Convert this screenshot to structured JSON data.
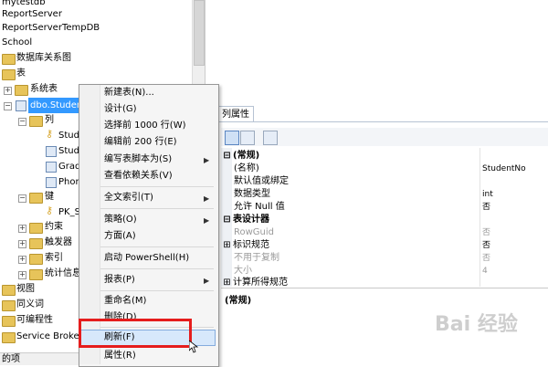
{
  "explorer": {
    "items": [
      {
        "label": "mytestdb",
        "level": 0
      },
      {
        "label": "ReportServer",
        "level": 0
      },
      {
        "label": "ReportServerTempDB",
        "level": 0
      },
      {
        "label": "School",
        "level": 0
      },
      {
        "label": "数据库关系图",
        "level": 1
      },
      {
        "label": "表",
        "level": 1
      },
      {
        "label": "系统表",
        "level": 2
      },
      {
        "label": "dbo.Studen",
        "level": 2,
        "selected": true
      },
      {
        "label": "列",
        "level": 3
      },
      {
        "label": "Studen",
        "level": 4
      },
      {
        "label": "Studen",
        "level": 4
      },
      {
        "label": "Grad",
        "level": 4
      },
      {
        "label": "Phor",
        "level": 4
      },
      {
        "label": "键",
        "level": 3
      },
      {
        "label": "PK_S",
        "level": 4
      },
      {
        "label": "约束",
        "level": 3
      },
      {
        "label": "触发器",
        "level": 3
      },
      {
        "label": "索引",
        "level": 3
      },
      {
        "label": "统计信息",
        "level": 3
      },
      {
        "label": "视图",
        "level": 1
      },
      {
        "label": "同义词",
        "level": 1
      },
      {
        "label": "可编程性",
        "level": 1
      },
      {
        "label": "Service Broke",
        "level": 1
      }
    ]
  },
  "statusbar": {
    "text": "的项"
  },
  "context_menu": {
    "items": [
      {
        "label": "新建表(N)...",
        "submenu": false
      },
      {
        "label": "设计(G)",
        "submenu": false
      },
      {
        "label": "选择前 1000 行(W)",
        "submenu": false
      },
      {
        "label": "编辑前 200 行(E)",
        "submenu": false
      },
      {
        "label": "编写表脚本为(S)",
        "submenu": true
      },
      {
        "label": "查看依赖关系(V)",
        "submenu": false
      },
      {
        "label": "全文索引(T)",
        "submenu": true
      },
      {
        "label": "策略(O)",
        "submenu": true
      },
      {
        "label": "方面(A)",
        "submenu": false
      },
      {
        "label": "启动 PowerShell(H)",
        "submenu": false
      },
      {
        "label": "报表(P)",
        "submenu": true
      },
      {
        "label": "重命名(M)",
        "submenu": false
      },
      {
        "label": "删除(D)",
        "submenu": false
      },
      {
        "label": "刷新(F)",
        "submenu": false,
        "highlighted": true
      },
      {
        "label": "属性(R)",
        "submenu": false
      }
    ]
  },
  "properties": {
    "tab_label": "列属性",
    "rows": [
      {
        "name": "(常规)",
        "value": "",
        "category": true
      },
      {
        "name": "(名称)",
        "value": "StudentNo"
      },
      {
        "name": "默认值或绑定",
        "value": ""
      },
      {
        "name": "数据类型",
        "value": "int"
      },
      {
        "name": "允许 Null 值",
        "value": "否"
      },
      {
        "name": "表设计器",
        "value": "",
        "category": true
      },
      {
        "name": "RowGuid",
        "value": "否",
        "dim": true
      },
      {
        "name": "标识规范",
        "value": "否"
      },
      {
        "name": "不用于复制",
        "value": "否",
        "dim": true
      },
      {
        "name": "大小",
        "value": "4",
        "dim": true
      },
      {
        "name": "计算所得规范",
        "value": ""
      }
    ],
    "description_title": "(常规)"
  },
  "watermark": {
    "text": "Bai 经验"
  }
}
